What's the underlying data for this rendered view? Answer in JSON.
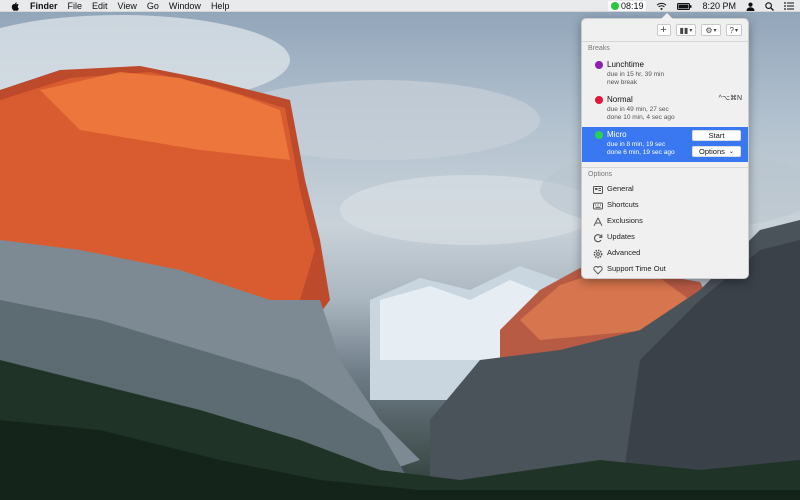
{
  "menubar": {
    "app_name": "Finder",
    "menus": [
      "File",
      "Edit",
      "View",
      "Go",
      "Window",
      "Help"
    ],
    "timer": "08:19",
    "timer_color": "#28c840",
    "clock": "8:20 PM"
  },
  "panel": {
    "toolbar": {
      "add": "+",
      "pause": "▮▮",
      "settings": "⚙",
      "help": "?"
    },
    "breaks_label": "Breaks",
    "breaks": [
      {
        "name": "Lunchtime",
        "color": "#8e1fb0",
        "line1": "due in 15 hr, 39 min",
        "line2": "new break",
        "shortcut": ""
      },
      {
        "name": "Normal",
        "color": "#e3163a",
        "line1": "due in 49 min, 27 sec",
        "line2": "done 10 min, 4 sec ago",
        "shortcut": "^⌥⌘N"
      },
      {
        "name": "Micro",
        "color": "#2ad150",
        "line1": "due in 8 min, 19 sec",
        "line2": "done 6 min, 19 sec ago",
        "start_label": "Start",
        "options_label": "Options",
        "selected": true
      }
    ],
    "options_label": "Options",
    "options": [
      {
        "label": "General",
        "icon": "general-icon"
      },
      {
        "label": "Shortcuts",
        "icon": "keyboard-icon"
      },
      {
        "label": "Exclusions",
        "icon": "exclusions-icon"
      },
      {
        "label": "Updates",
        "icon": "refresh-icon"
      },
      {
        "label": "Advanced",
        "icon": "gear-icon"
      },
      {
        "label": "Support Time Out",
        "icon": "heart-icon"
      }
    ]
  }
}
